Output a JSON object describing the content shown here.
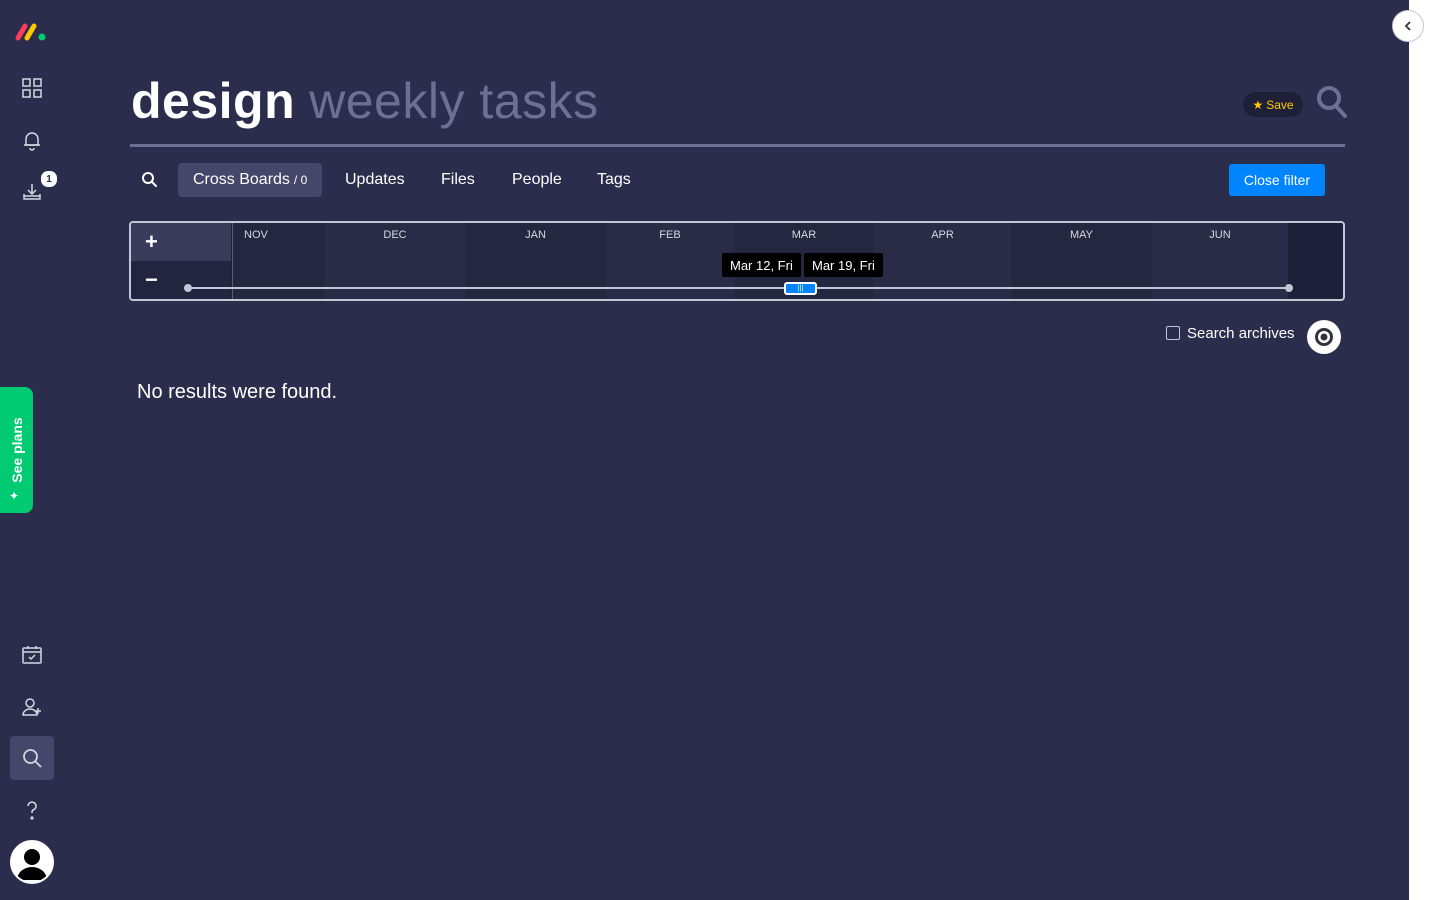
{
  "header": {
    "title_primary": "design",
    "title_secondary": "weekly tasks",
    "save_label": "Save"
  },
  "rail": {
    "download_badge": "1",
    "see_plans_label": "See plans"
  },
  "tabs": [
    {
      "label": "Cross Boards",
      "count": "/ 0",
      "active": true
    },
    {
      "label": "Updates"
    },
    {
      "label": "Files"
    },
    {
      "label": "People"
    },
    {
      "label": "Tags"
    }
  ],
  "close_filter_label": "Close filter",
  "timeline": {
    "months": [
      "NOV",
      "DEC",
      "JAN",
      "FEB",
      "MAR",
      "APR",
      "MAY",
      "JUN"
    ],
    "range_start": "Mar 12, Fri",
    "range_end": "Mar 19, Fri"
  },
  "archives_label": "Search archives",
  "no_results_text": "No results were found.",
  "colors": {
    "background": "#2b2d4d",
    "primary_button": "#0085ff",
    "see_plans": "#00ca72",
    "save_star": "#ffcb00"
  }
}
